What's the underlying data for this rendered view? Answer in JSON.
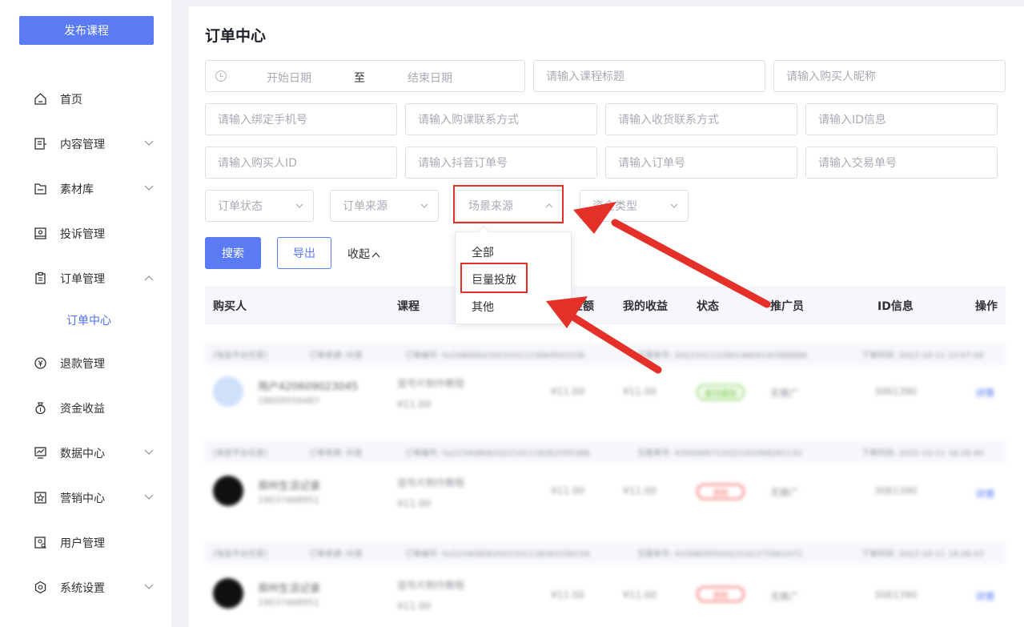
{
  "sidebar": {
    "publish_label": "发布课程",
    "items": [
      {
        "label": "首页",
        "icon": "home-icon",
        "chevron": false
      },
      {
        "label": "内容管理",
        "icon": "content-icon",
        "chevron": true
      },
      {
        "label": "素材库",
        "icon": "folder-icon",
        "chevron": true
      },
      {
        "label": "投诉管理",
        "icon": "complaint-icon",
        "chevron": false
      },
      {
        "label": "订单管理",
        "icon": "clipboard-icon",
        "chevron": true
      },
      {
        "label": "退款管理",
        "icon": "refund-icon",
        "chevron": false
      },
      {
        "label": "资金收益",
        "icon": "moneybag-icon",
        "chevron": false
      },
      {
        "label": "数据中心",
        "icon": "chart-icon",
        "chevron": true
      },
      {
        "label": "营销中心",
        "icon": "star-icon",
        "chevron": true
      },
      {
        "label": "用户管理",
        "icon": "user-search-icon",
        "chevron": false
      },
      {
        "label": "系统设置",
        "icon": "settings-icon",
        "chevron": true
      }
    ],
    "sub_item": "订单中心"
  },
  "page": {
    "title": "订单中心"
  },
  "filters": {
    "date_start": "开始日期",
    "date_sep": "至",
    "date_end": "结束日期",
    "course_title": "请输入课程标题",
    "buyer_nickname": "请输入购买人昵称",
    "bind_phone": "请输入绑定手机号",
    "buy_contact": "请输入购课联系方式",
    "ship_contact": "请输入收货联系方式",
    "id_info": "请输入ID信息",
    "buyer_id": "请输入购买人ID",
    "douyin_order": "请输入抖音订单号",
    "order_no": "请输入订单号",
    "trade_no": "请输入交易单号",
    "order_status": "订单状态",
    "order_source": "订单来源",
    "scene_source": "场景来源",
    "fund_type": "资金类型"
  },
  "actions": {
    "search": "搜索",
    "export": "导出",
    "collapse": "收起"
  },
  "dropdown": {
    "options": [
      "全部",
      "巨量投放",
      "其他"
    ]
  },
  "table": {
    "headers": [
      "购买人",
      "课程",
      "金额",
      "我的收益",
      "状态",
      "推广员",
      "ID信息",
      "操作"
    ]
  },
  "rows": [
    {
      "meta": [
        "[淘宝平台任意]",
        "订单来源: 抖音",
        "订单编号: hx20609022023101123064501536",
        "交易单号: 20221011229014604142588886",
        "下单时间: 2022-10-11 23:07:00"
      ],
      "name": "用户420609023045",
      "phone": "18609556487",
      "course": "竖号片制作教程",
      "course_price": "¥11.00",
      "amount": "¥11.00",
      "income": "¥11.00",
      "status": "支付成功",
      "promoter": "无推广",
      "id_info": "3061390",
      "action": "详情"
    },
    {
      "meta": [
        "[淘宝平台任意]",
        "订单来源: 抖音",
        "订单编号: hx223408062022101118262555368",
        "交易单号: 4350069712022101096261132",
        "下单时间: 2022-10-11 18:26:40"
      ],
      "name": "郑州生活记录",
      "phone": "18037468951",
      "course": "竖号片制作教程",
      "course_price": "¥11.00",
      "amount": "¥11.00",
      "income": "¥11.00",
      "status": "退款",
      "promoter": "无推广",
      "id_info": "3061390",
      "action": "详情"
    },
    {
      "meta": [
        "[淘宝平台任意]",
        "订单来源: 抖音",
        "订单编号: hx223408062022101118263150159",
        "交易单号: 4339809552022101272961472",
        "下单时间: 2022-10-11 18:26:43"
      ],
      "name": "郑州生活记录",
      "phone": "18037468951",
      "course": "竖号片制作教程",
      "course_price": "¥11.00",
      "amount": "¥11.00",
      "income": "¥11.00",
      "status": "退款",
      "promoter": "无推广",
      "id_info": "3061390",
      "action": "详情"
    }
  ],
  "colors": {
    "primary": "#5a7bf3",
    "highlight": "#e5302a",
    "success": "#52c41a",
    "danger": "#f56c6c"
  }
}
